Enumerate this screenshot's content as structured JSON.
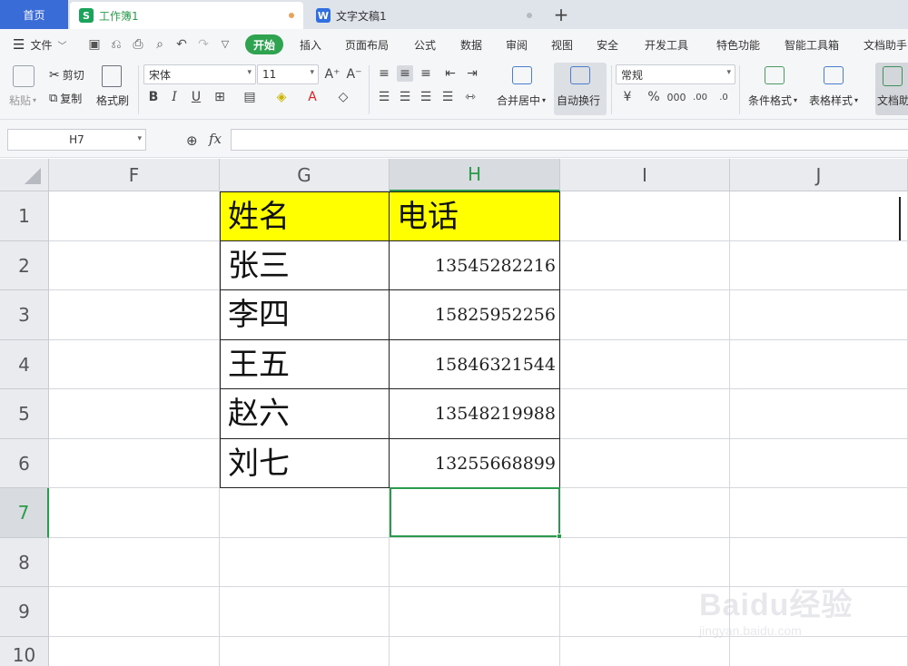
{
  "tabs": {
    "home": "首页",
    "workbook": "工作簿1",
    "workbook_logo": "S",
    "document": "文字文稿1",
    "document_logo": "W",
    "new_tab": "+"
  },
  "menu": {
    "file": "文件",
    "start": "开始",
    "insert": "插入",
    "page_layout": "页面布局",
    "formula": "公式",
    "data": "数据",
    "review": "审阅",
    "view": "视图",
    "security": "安全",
    "developer": "开发工具",
    "special": "特色功能",
    "smart_tools": "智能工具箱",
    "doc_helper": "文档助手"
  },
  "ribbon": {
    "paste": "粘贴",
    "cut": "剪切",
    "copy": "复制",
    "format_painter": "格式刷",
    "font_name": "宋体",
    "font_size": "11",
    "bold": "B",
    "italic": "I",
    "underline": "U",
    "merge_center": "合并居中",
    "auto_wrap": "自动换行",
    "number_format": "常规",
    "conditional_format": "条件格式",
    "table_style": "表格样式",
    "doc_helper": "文档助"
  },
  "formula_bar": {
    "cell_ref": "H7",
    "fx": "fx"
  },
  "sheet": {
    "columns": [
      "F",
      "G",
      "H",
      "I",
      "J"
    ],
    "rows": [
      "1",
      "2",
      "3",
      "4",
      "5",
      "6",
      "7",
      "8",
      "9",
      "10"
    ],
    "header_name": "姓名",
    "header_phone": "电话",
    "records": [
      {
        "name": "张三",
        "phone": "13545282216"
      },
      {
        "name": "李四",
        "phone": "15825952256"
      },
      {
        "name": "王五",
        "phone": "15846321544"
      },
      {
        "name": "赵六",
        "phone": "13548219988"
      },
      {
        "name": "刘七",
        "phone": "13255668899"
      }
    ],
    "selected_cell": "H7"
  },
  "watermark": {
    "brand": "Baidu经验",
    "url": "jingyan.baidu.com"
  },
  "colors": {
    "accent_green": "#2a9b4b",
    "home_tab_blue": "#3a6cd8",
    "header_fill": "#ffff00"
  }
}
